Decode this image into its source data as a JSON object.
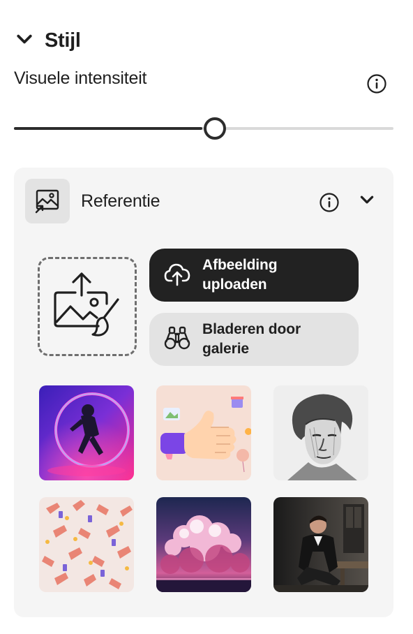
{
  "style_section": {
    "title": "Stijl",
    "chevron_icon": "chevron-down-icon"
  },
  "intensity": {
    "label": "Visuele intensiteit",
    "info_icon": "info-icon",
    "slider_value_fraction": 0.5
  },
  "reference": {
    "title": "Referentie",
    "header_icon": "image-reference-icon",
    "info_icon": "info-icon",
    "chevron_icon": "chevron-down-icon",
    "drop_zone_icon": "image-upload-edit-icon",
    "upload_button": {
      "label": "Afbeelding uploaden",
      "icon": "cloud-upload-icon"
    },
    "browse_button": {
      "label": "Bladeren door galerie",
      "icon": "binoculars-icon"
    },
    "gallery": [
      {
        "name": "neon-astronaut-thumbnail"
      },
      {
        "name": "thumbs-up-hand-thumbnail"
      },
      {
        "name": "engraving-portrait-thumbnail"
      },
      {
        "name": "hands-pattern-thumbnail"
      },
      {
        "name": "pink-clouds-thumbnail"
      },
      {
        "name": "man-in-suit-thumbnail"
      }
    ]
  },
  "colors": {
    "primary_button_bg": "#222222",
    "secondary_button_bg": "#e3e3e3",
    "card_bg": "#f5f5f5",
    "slider_fill": "#2c2c2c",
    "slider_track": "#d9d9d9"
  }
}
